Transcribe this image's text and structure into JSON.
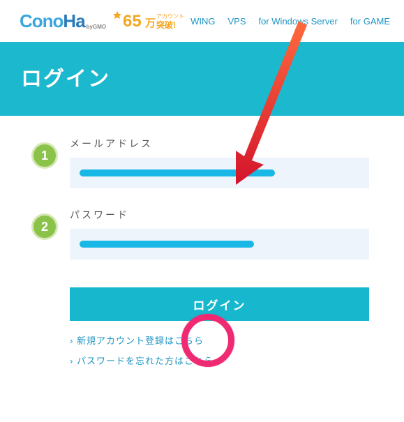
{
  "header": {
    "logo_main": "ConoHa",
    "logo_sub": "byGMO",
    "badge_number": "65",
    "badge_unit": "万",
    "badge_small_top": "アカウント",
    "badge_small_bottom": "突破!",
    "nav": [
      "WING",
      "VPS",
      "for Windows Server",
      "for GAME"
    ]
  },
  "hero": {
    "title": "ログイン"
  },
  "form": {
    "fields": [
      {
        "num": "1",
        "label": "メールアドレス"
      },
      {
        "num": "2",
        "label": "パスワード"
      }
    ],
    "login_button": "ログイン",
    "links": [
      "新規アカウント登録はこちら",
      "パスワードを忘れた方はこちら"
    ]
  }
}
